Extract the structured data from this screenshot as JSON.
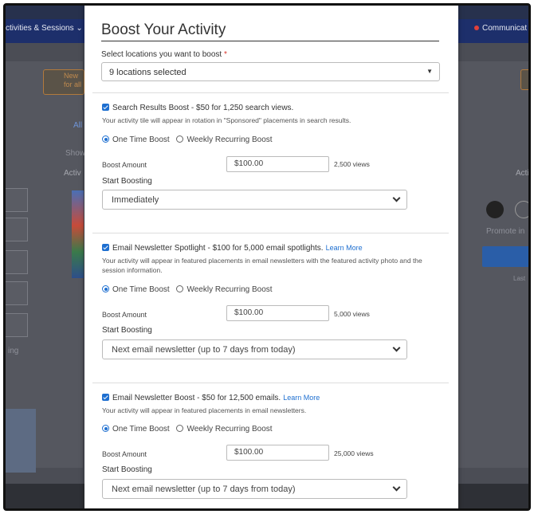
{
  "background": {
    "nav_left": "ctivities & Sessions",
    "nav_left_caret": "⌄",
    "nav_right": "Communicat",
    "orange_banner": "New\nfor all",
    "tab_all": "All",
    "text_show": "Show",
    "text_activ": "Activ",
    "text_acti": "Acti",
    "text_promote": "Promote in",
    "text_last": "Last",
    "text_ing": "ing"
  },
  "modal": {
    "title": "Boost Your Activity",
    "locations_label": "Select locations you want to boost",
    "required_mark": "*",
    "locations_value": "9 locations selected",
    "sections": [
      {
        "header": "Search Results Boost - $50 for 1,250 search views.",
        "learn_more": "",
        "description": "Your activity tile will appear in rotation in \"Sponsored\" placements in search results.",
        "radio_one_time": "One Time Boost",
        "radio_weekly": "Weekly Recurring Boost",
        "amount_label": "Boost Amount",
        "amount_value": "$100.00",
        "views": "2,500 views",
        "start_label": "Start Boosting",
        "start_value": "Immediately"
      },
      {
        "header": "Email Newsletter Spotlight - $100 for 5,000 email spotlights.",
        "learn_more": "Learn More",
        "description": "Your activity will appear in featured placements in email newsletters with the featured activity photo and the session information.",
        "radio_one_time": "One Time Boost",
        "radio_weekly": "Weekly Recurring Boost",
        "amount_label": "Boost Amount",
        "amount_value": "$100.00",
        "views": "5,000 views",
        "start_label": "Start Boosting",
        "start_value": "Next email newsletter (up to 7 days from today)"
      },
      {
        "header": "Email Newsletter Boost - $50 for 12,500 emails.",
        "learn_more": "Learn More",
        "description": "Your activity will appear in featured placements in email newsletters.",
        "radio_one_time": "One Time Boost",
        "radio_weekly": "Weekly Recurring Boost",
        "amount_label": "Boost Amount",
        "amount_value": "$100.00",
        "views": "25,000 views",
        "start_label": "Start Boosting",
        "start_value": "Next email newsletter (up to 7 days from today)"
      }
    ]
  },
  "colors": {
    "accent": "#1e6fd0",
    "required": "#d9342b",
    "nav": "#1d2f6b"
  }
}
